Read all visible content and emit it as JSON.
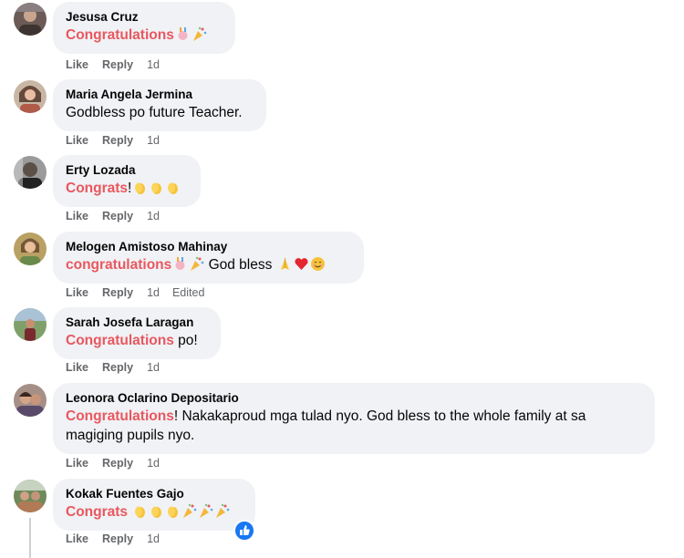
{
  "comments": [
    {
      "author": "Jesusa Cruz",
      "segments": [
        {
          "text": "Congratulations",
          "hl": true
        }
      ],
      "emojis": [
        "confetti-ball",
        "party-popper"
      ],
      "actions": {
        "like": "Like",
        "reply": "Reply",
        "time": "1d"
      }
    },
    {
      "author": "Maria Angela Jermina",
      "segments": [
        {
          "text": "Godbless po future Teacher.",
          "hl": false
        }
      ],
      "emojis": [],
      "actions": {
        "like": "Like",
        "reply": "Reply",
        "time": "1d"
      }
    },
    {
      "author": "Erty Lozada",
      "segments": [
        {
          "text": "Congrats",
          "hl": true
        },
        {
          "text": "!",
          "hl": false
        }
      ],
      "emojis": [
        "clapping-hands",
        "clapping-hands",
        "clapping-hands"
      ],
      "actions": {
        "like": "Like",
        "reply": "Reply",
        "time": "1d"
      }
    },
    {
      "author": "Melogen Amistoso Mahinay",
      "segments": [
        {
          "text": "congratulations",
          "hl": true
        }
      ],
      "emojis": [
        "confetti-ball",
        "party-popper"
      ],
      "after_text": " God bless ",
      "after_emojis": [
        "folded-hands",
        "red-heart",
        "smiling-face"
      ],
      "actions": {
        "like": "Like",
        "reply": "Reply",
        "time": "1d",
        "edited": "Edited"
      }
    },
    {
      "author": "Sarah Josefa Laragan",
      "segments": [
        {
          "text": "Congratulations",
          "hl": true
        },
        {
          "text": " po!",
          "hl": false
        }
      ],
      "emojis": [],
      "actions": {
        "like": "Like",
        "reply": "Reply",
        "time": "1d"
      }
    },
    {
      "author": "Leonora Oclarino Depositario",
      "segments": [
        {
          "text": "Congratulations",
          "hl": true
        },
        {
          "text": "! Nakakaproud mga tulad nyo. God bless to the whole family at sa magiging pupils nyo.",
          "hl": false
        }
      ],
      "emojis": [],
      "actions": {
        "like": "Like",
        "reply": "Reply",
        "time": "1d"
      }
    },
    {
      "author": "Kokak Fuentes Gajo",
      "segments": [
        {
          "text": "Congrats ",
          "hl": true
        }
      ],
      "emojis": [
        "clapping-hands",
        "clapping-hands",
        "clapping-hands",
        "party-popper",
        "party-popper",
        "party-popper"
      ],
      "reaction": "like-reaction-icon",
      "actions": {
        "like": "Like",
        "reply": "Reply",
        "time": "1d"
      }
    }
  ],
  "colors": {
    "highlight": "#e9575f",
    "bubble": "#f0f2f5",
    "meta": "#65676b",
    "reaction": "#1877f2"
  }
}
